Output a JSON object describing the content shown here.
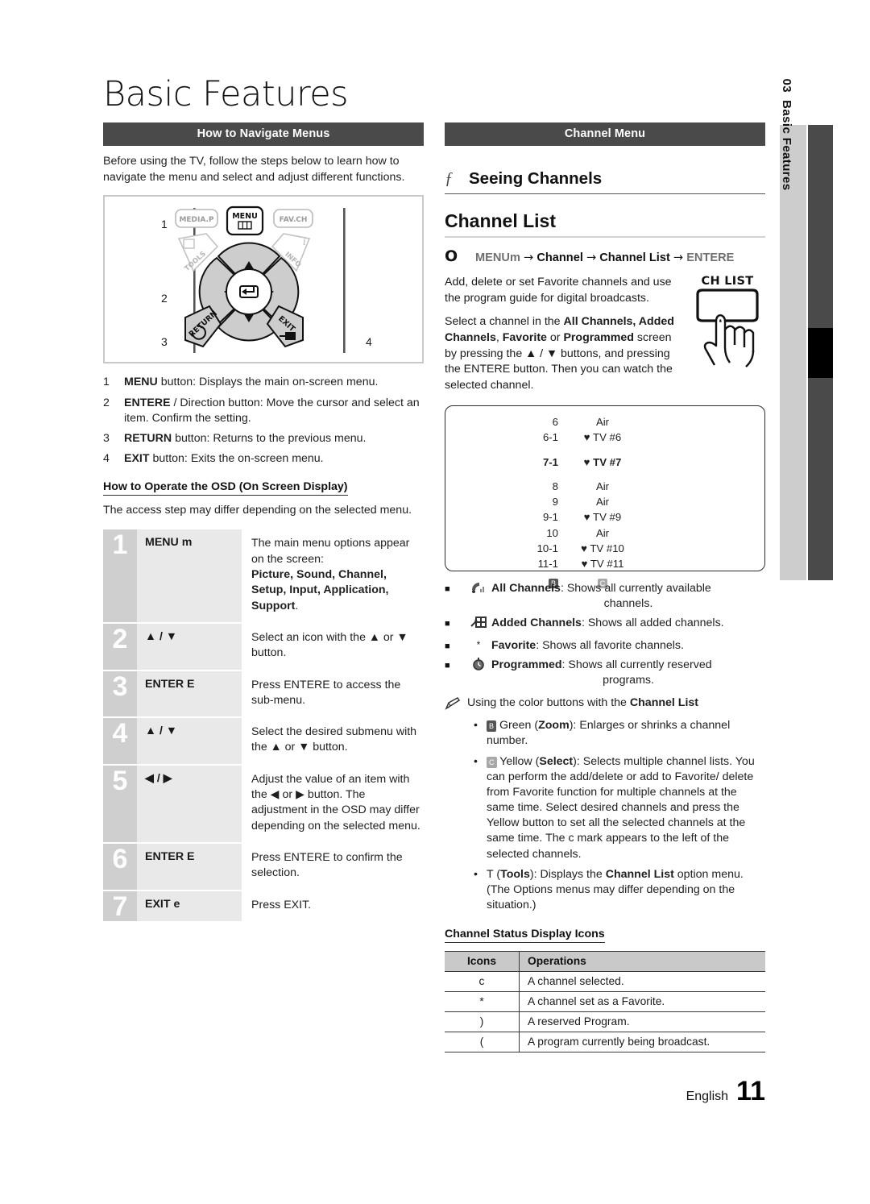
{
  "page": {
    "title": "Basic Features",
    "footer_language": "English",
    "footer_page": "11",
    "side_tab_number": "03",
    "side_tab_label": "Basic Features"
  },
  "left": {
    "section_bar": "How to Navigate Menus",
    "intro": "Before using the TV, follow the steps below to learn how to navigate the menu and select and adjust different functions.",
    "remote_figure": {
      "callouts": [
        "1",
        "2",
        "3",
        "4"
      ],
      "buttons": [
        "MEDIA.P",
        "MENU",
        "FAV.CH",
        "TOOLS",
        "INFO",
        "RETURN",
        "EXIT"
      ]
    },
    "numbered_items": [
      {
        "n": "1",
        "strong": "MENU",
        "text": " button: Displays the main on-screen menu."
      },
      {
        "n": "2",
        "strong": "ENTERE",
        "text": "   / Direction button: Move the cursor and select an item. Confirm the setting."
      },
      {
        "n": "3",
        "strong": "RETURN",
        "text": " button: Returns to the previous menu."
      },
      {
        "n": "4",
        "strong": "EXIT",
        "text": " button: Exits the on-screen menu."
      }
    ],
    "osd_heading": "How to Operate the OSD (On Screen Display)",
    "osd_note": "The access step may differ depending on the selected menu.",
    "osd_steps": [
      {
        "num": "1",
        "button": "MENU m",
        "desc_plain": "The main menu options appear on the screen:",
        "desc_bold": "Picture, Sound, Channel, Setup, Input, Application, Support",
        "desc_tail": "."
      },
      {
        "num": "2",
        "button": "▲ / ▼",
        "desc_plain": "Select an icon with the ▲ or ▼ button.",
        "desc_bold": "",
        "desc_tail": ""
      },
      {
        "num": "3",
        "button": "ENTER E",
        "desc_plain": "Press ENTERE    to access the sub-menu.",
        "desc_bold": "",
        "desc_tail": ""
      },
      {
        "num": "4",
        "button": "▲ / ▼",
        "desc_plain": "Select the desired submenu with the ▲ or ▼ button.",
        "desc_bold": "",
        "desc_tail": ""
      },
      {
        "num": "5",
        "button": "◀ / ▶",
        "desc_plain": "Adjust the value of an item with the ◀ or ▶ button. The adjustment in the OSD may differ depending on the selected menu.",
        "desc_bold": "",
        "desc_tail": ""
      },
      {
        "num": "6",
        "button": "ENTER E",
        "desc_plain": "Press ENTERE    to confirm the selection.",
        "desc_bold": "",
        "desc_tail": ""
      },
      {
        "num": "7",
        "button": "EXIT e",
        "desc_plain": "Press EXIT.",
        "desc_bold": "",
        "desc_tail": ""
      }
    ]
  },
  "right": {
    "section_bar": "Channel Menu",
    "feature_glyph": "ƒ",
    "feature_label": "Seeing Channels",
    "channel_list_heading": "Channel List",
    "menu_path": {
      "circle": "O",
      "first": "MENUm",
      "arrow": "→",
      "steps": [
        "Channel",
        "Channel List"
      ],
      "last": "ENTERE"
    },
    "intro_p1": "Add, delete or set Favorite channels and use the program guide for digital broadcasts.",
    "intro_p2_a": "Select a channel in the ",
    "intro_p2_b": "All Channels, Added Channels",
    "intro_p2_c": ", ",
    "intro_p2_d": "Favorite",
    "intro_p2_e": " or ",
    "intro_p2_f": "Programmed",
    "intro_p2_g": " screen by pressing the ▲ / ▼ buttons, and pressing the ENTERE    button. Then you can watch the selected channel.",
    "chlist_button_caption": "CH LIST",
    "channel_screen": {
      "rows": [
        {
          "num": "6",
          "name": "Air",
          "fav": false,
          "bold": false,
          "spacer_after": false
        },
        {
          "num": "6-1",
          "name": "TV #6",
          "fav": true,
          "bold": false,
          "spacer_after": true
        },
        {
          "num": "7-1",
          "name": "TV #7",
          "fav": true,
          "bold": true,
          "spacer_after": true
        },
        {
          "num": "8",
          "name": "Air",
          "fav": false,
          "bold": false,
          "spacer_after": false
        },
        {
          "num": "9",
          "name": "Air",
          "fav": false,
          "bold": false,
          "spacer_after": false
        },
        {
          "num": "9-1",
          "name": "TV #9",
          "fav": true,
          "bold": false,
          "spacer_after": false
        },
        {
          "num": "10",
          "name": "Air",
          "fav": false,
          "bold": false,
          "spacer_after": false
        },
        {
          "num": "10-1",
          "name": "TV #10",
          "fav": true,
          "bold": false,
          "spacer_after": false
        },
        {
          "num": "11-1",
          "name": "TV #11",
          "fav": true,
          "bold": false,
          "spacer_after": false
        }
      ],
      "key_b": "B",
      "key_c": "C"
    },
    "list_modes": [
      {
        "icon": "antenna-icon",
        "name": "All Channels",
        "desc": ": Shows all currently available",
        "desc2": "channels."
      },
      {
        "icon": "add-plus-icon",
        "name": "Added Channels",
        "desc": ": Shows all added channels.",
        "desc2": ""
      },
      {
        "icon": "asterisk-icon",
        "name": "Favorite",
        "desc": ": Shows all favorite channels.",
        "desc2": ""
      },
      {
        "icon": "clock-icon",
        "name": "Programmed",
        "desc": ": Shows all currently reserved",
        "desc2": "programs."
      }
    ],
    "note_head_a": "Using the color buttons with the ",
    "note_head_b": "Channel List",
    "color_buttons": [
      {
        "key": "B",
        "key_style": "dark",
        "color_name": "Green",
        "paren_open": " (",
        "bold_label": "Zoom",
        "paren_close": "): ",
        "text": "Enlarges or shrinks a channel number."
      },
      {
        "key": "C",
        "key_style": "light",
        "color_name": "Yellow",
        "paren_open": " (",
        "bold_label": "Select",
        "paren_close": "): ",
        "text": "Selects multiple channel lists. You can perform the add/delete or add to Favorite/ delete from Favorite function for multiple channels at the same time. Select desired channels and press the Yellow button to set all the selected channels at the same time. The c    mark appears to the left of the selected channels."
      }
    ],
    "tools_bullet": {
      "key": "T",
      "paren_open": "   (",
      "bold_label": "Tools",
      "mid": "): Displays the ",
      "bold_label2": "Channel List",
      "tail": " option menu. (The Options menus may differ depending on the situation.)"
    },
    "status_table": {
      "heading": "Channel Status Display Icons",
      "columns": [
        "Icons",
        "Operations"
      ],
      "rows": [
        {
          "icon": "c",
          "operation": "A channel selected."
        },
        {
          "icon": "*",
          "operation": "A channel set as a Favorite."
        },
        {
          "icon": ")",
          "operation": "A reserved Program."
        },
        {
          "icon": "(",
          "operation": "A program currently being broadcast."
        }
      ]
    }
  },
  "colors": {
    "section_bar_bg": "#4a4a4a",
    "side_tab_bg": "#cdcdcd",
    "side_bar_dark": "#4a4a4a",
    "side_bar_black": "#000000",
    "step_num_bg": "#cfcfcf",
    "step_btn_bg": "#e9e9e9",
    "table_header_bg": "#c9c9c9"
  }
}
